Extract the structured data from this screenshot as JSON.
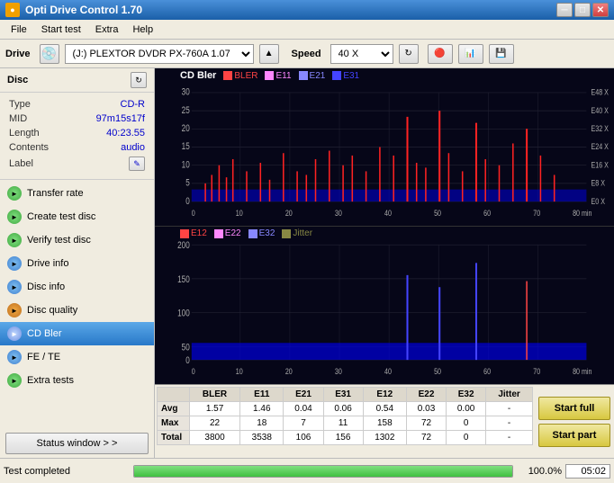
{
  "titlebar": {
    "title": "Opti Drive Control 1.70",
    "min_label": "─",
    "max_label": "□",
    "close_label": "✕",
    "icon": "●"
  },
  "menubar": {
    "items": [
      {
        "label": "File"
      },
      {
        "label": "Start test"
      },
      {
        "label": "Extra"
      },
      {
        "label": "Help"
      }
    ]
  },
  "drivebar": {
    "drive_label": "Drive",
    "drive_value": "(J:)  PLEXTOR DVDR  PX-760A 1.07",
    "speed_label": "Speed",
    "speed_value": "40 X"
  },
  "disc": {
    "header": "Disc",
    "refresh_icon": "↻",
    "type_label": "Type",
    "type_value": "CD-R",
    "mid_label": "MID",
    "mid_value": "97m15s17f",
    "length_label": "Length",
    "length_value": "40:23.55",
    "contents_label": "Contents",
    "contents_value": "audio",
    "label_label": "Label",
    "label_value": ""
  },
  "nav": {
    "items": [
      {
        "id": "transfer-rate",
        "label": "Transfer rate",
        "icon": "►"
      },
      {
        "id": "create-test-disc",
        "label": "Create test disc",
        "icon": "►"
      },
      {
        "id": "verify-test-disc",
        "label": "Verify test disc",
        "icon": "►"
      },
      {
        "id": "drive-info",
        "label": "Drive info",
        "icon": "►"
      },
      {
        "id": "disc-info",
        "label": "Disc info",
        "icon": "►"
      },
      {
        "id": "disc-quality",
        "label": "Disc quality",
        "icon": "►"
      },
      {
        "id": "cd-bler",
        "label": "CD Bler",
        "icon": "►",
        "active": true
      },
      {
        "id": "fe-te",
        "label": "FE / TE",
        "icon": "►"
      },
      {
        "id": "extra-tests",
        "label": "Extra tests",
        "icon": "►"
      }
    ],
    "status_window_label": "Status window > >"
  },
  "chart_top": {
    "title": "CD Bler",
    "legend": [
      {
        "label": "BLER",
        "color": "#ff4444"
      },
      {
        "label": "E11",
        "color": "#ff88ff"
      },
      {
        "label": "E21",
        "color": "#8888ff"
      },
      {
        "label": "E31",
        "color": "#4444ff"
      }
    ],
    "y_labels": [
      "30",
      "25",
      "20",
      "15",
      "10",
      "5",
      "0"
    ],
    "x_labels": [
      "0",
      "10",
      "20",
      "30",
      "40",
      "50",
      "60",
      "70",
      "80 min"
    ],
    "right_labels": [
      "E48 X",
      "E40 X",
      "E32 X",
      "E24 X",
      "E16 X",
      "E8 X",
      "E0 X"
    ]
  },
  "chart_bottom": {
    "legend": [
      {
        "label": "E12",
        "color": "#ff4444"
      },
      {
        "label": "E22",
        "color": "#ff88ff"
      },
      {
        "label": "E32",
        "color": "#8888ff"
      },
      {
        "label": "Jitter",
        "color": "#888844"
      }
    ],
    "y_labels": [
      "200",
      "150",
      "100",
      "50",
      "0"
    ],
    "x_labels": [
      "0",
      "10",
      "20",
      "30",
      "40",
      "50",
      "60",
      "70",
      "80 min"
    ]
  },
  "stats": {
    "columns": [
      "BLER",
      "E11",
      "E21",
      "E31",
      "E12",
      "E22",
      "E32",
      "Jitter"
    ],
    "rows": [
      {
        "label": "Avg",
        "values": [
          "1.57",
          "1.46",
          "0.04",
          "0.06",
          "0.54",
          "0.03",
          "0.00",
          "-"
        ]
      },
      {
        "label": "Max",
        "values": [
          "22",
          "18",
          "7",
          "11",
          "158",
          "72",
          "0",
          "-"
        ]
      },
      {
        "label": "Total",
        "values": [
          "3800",
          "3538",
          "106",
          "156",
          "1302",
          "72",
          "0",
          "-"
        ]
      }
    ]
  },
  "buttons": {
    "start_full_label": "Start full",
    "start_part_label": "Start part"
  },
  "statusbar": {
    "status_label": "Test completed",
    "progress_pct": "100.0%",
    "time": "05:02"
  }
}
